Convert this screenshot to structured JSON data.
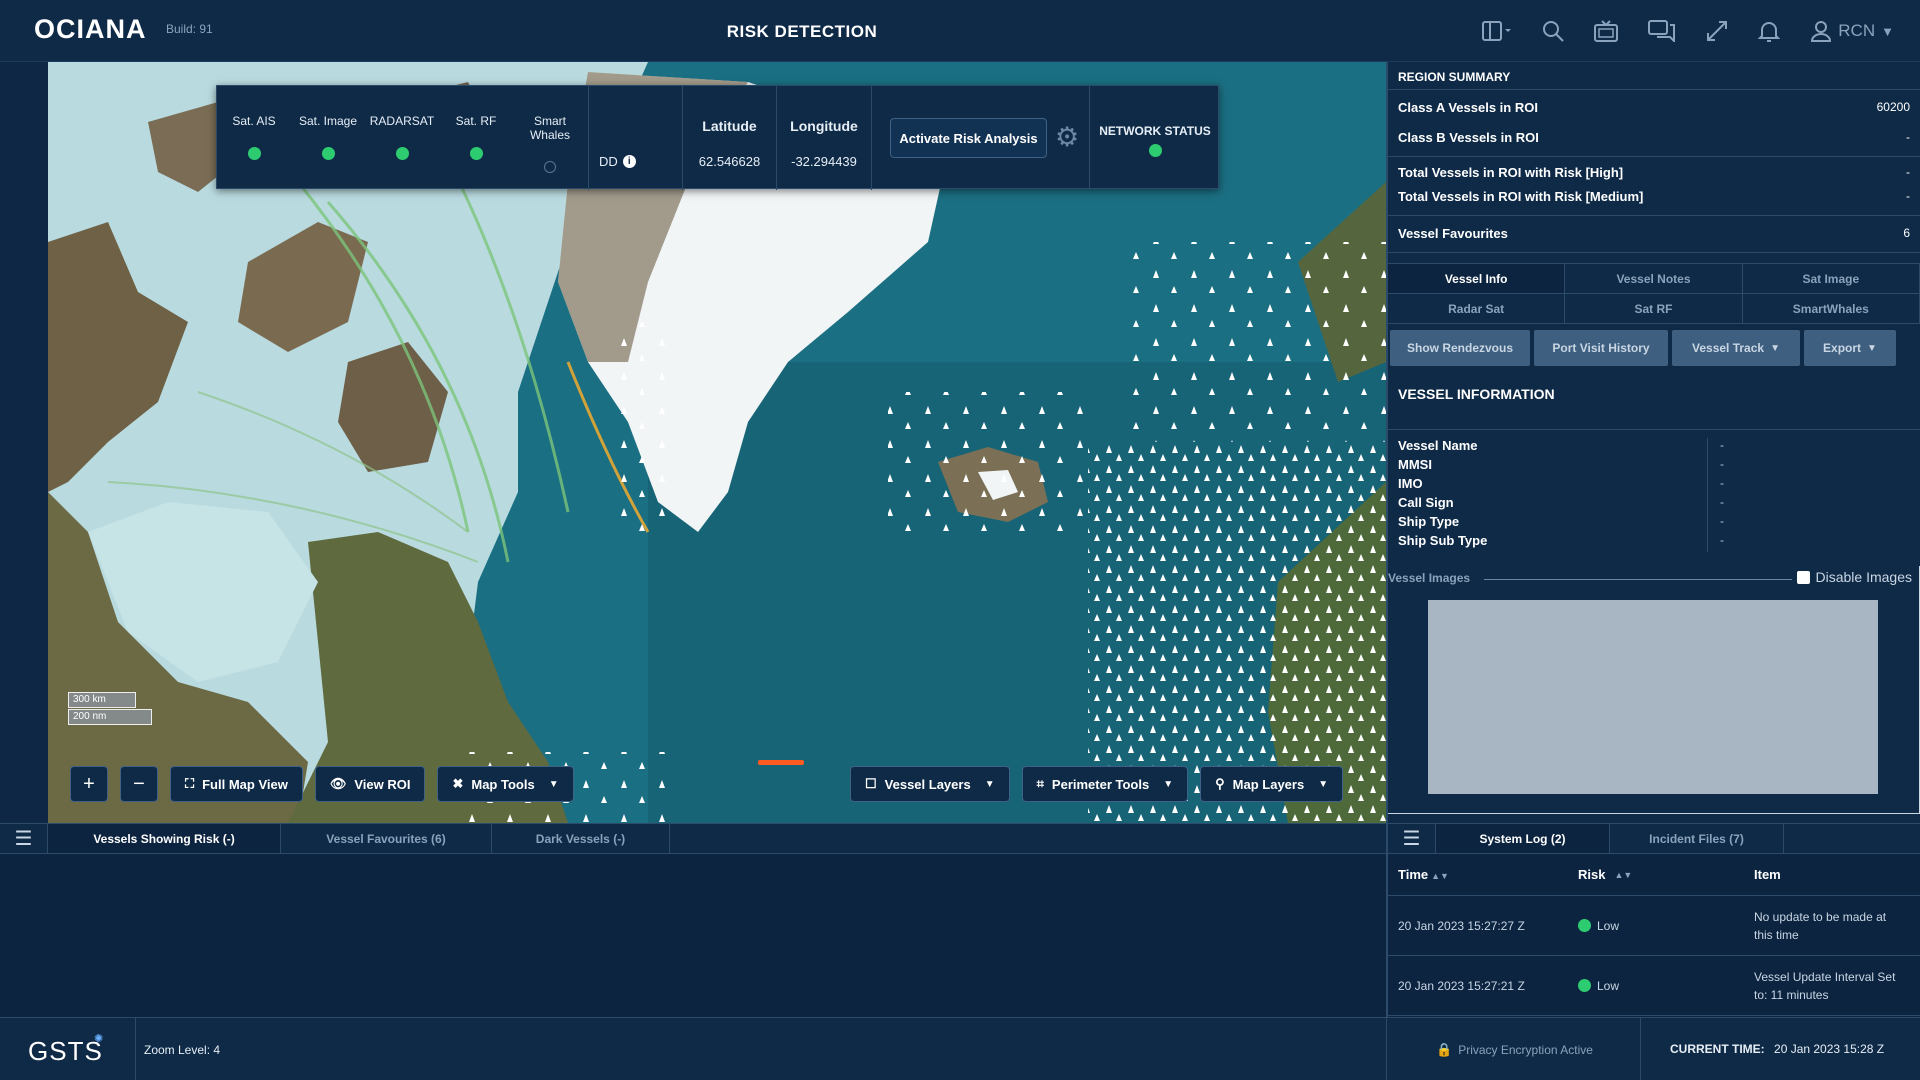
{
  "header": {
    "logo": "OCIANA",
    "build": "Build: 91",
    "title": "RISK DETECTION",
    "user": "RCN",
    "icons": [
      "layout-icon",
      "search-icon",
      "tv-icon",
      "chat-icon",
      "expand-icon",
      "bell-icon",
      "user-icon"
    ]
  },
  "sensors": [
    {
      "label": "Sat. AIS",
      "status": "on"
    },
    {
      "label": "Sat. Image",
      "status": "on"
    },
    {
      "label": "RADARSAT",
      "status": "on"
    },
    {
      "label": "Sat. RF",
      "status": "on"
    },
    {
      "label": "Smart Whales",
      "status": "off"
    }
  ],
  "coords": {
    "format": "DD",
    "latitude_label": "Latitude",
    "latitude": "62.546628",
    "longitude_label": "Longitude",
    "longitude": "-32.294439"
  },
  "risk_button": "Activate Risk Analysis",
  "network_status": "NETWORK STATUS",
  "scale": {
    "km": "300 km",
    "nm": "200 nm"
  },
  "map_controls": {
    "zoom_in": "+",
    "zoom_out": "−",
    "full_map": "Full Map View",
    "view_roi": "View ROI",
    "map_tools": "Map Tools",
    "vessel_layers": "Vessel Layers",
    "perimeter_tools": "Perimeter Tools",
    "map_layers": "Map Layers"
  },
  "region_summary": {
    "title": "REGION SUMMARY",
    "rows": [
      {
        "label": "Class A Vessels in ROI",
        "value": "60200"
      },
      {
        "label": "Class B Vessels in ROI",
        "value": "-"
      },
      {
        "label": "Total Vessels in ROI with Risk [High]",
        "value": "-"
      },
      {
        "label": "Total Vessels in ROI with Risk [Medium]",
        "value": "-"
      },
      {
        "label": "Vessel Favourites",
        "value": "6"
      }
    ]
  },
  "vessel_tabs": [
    "Vessel Info",
    "Vessel Notes",
    "Sat Image",
    "Radar Sat",
    "Sat RF",
    "SmartWhales"
  ],
  "vessel_buttons": {
    "rendezvous": "Show Rendezvous",
    "port_history": "Port Visit History",
    "track": "Vessel Track",
    "export": "Export"
  },
  "vessel_info": {
    "title": "VESSEL INFORMATION",
    "fields": [
      {
        "label": "Vessel Name",
        "value": "-"
      },
      {
        "label": "MMSI",
        "value": "-"
      },
      {
        "label": "IMO",
        "value": "-"
      },
      {
        "label": "Call Sign",
        "value": "-"
      },
      {
        "label": "Ship Type",
        "value": "-"
      },
      {
        "label": "Ship Sub Type",
        "value": "-"
      }
    ],
    "images_label": "Vessel Images",
    "disable_images": "Disable Images"
  },
  "bottom_tabs": [
    "Vessels Showing Risk (-)",
    "Vessel Favourites (6)",
    "Dark Vessels (-)"
  ],
  "log": {
    "tabs": [
      "System Log (2)",
      "Incident Files (7)"
    ],
    "headers": {
      "time": "Time",
      "risk": "Risk",
      "item": "Item"
    },
    "rows": [
      {
        "time": "20 Jan 2023 15:27:27 Z",
        "risk": "Low",
        "item": "No update to be made at this time"
      },
      {
        "time": "20 Jan 2023 15:27:21 Z",
        "risk": "Low",
        "item": "Vessel Update Interval Set to: 11 minutes"
      }
    ]
  },
  "footer": {
    "brand": "GSTS",
    "zoom": "Zoom Level: 4",
    "privacy": "Privacy Encryption Active",
    "current_time_label": "CURRENT TIME:",
    "current_time": "20 Jan 2023 15:28 Z"
  },
  "colors": {
    "status_on": "#2ecc71",
    "background": "#0c2440",
    "accent_orange": "#ff5a1f"
  }
}
